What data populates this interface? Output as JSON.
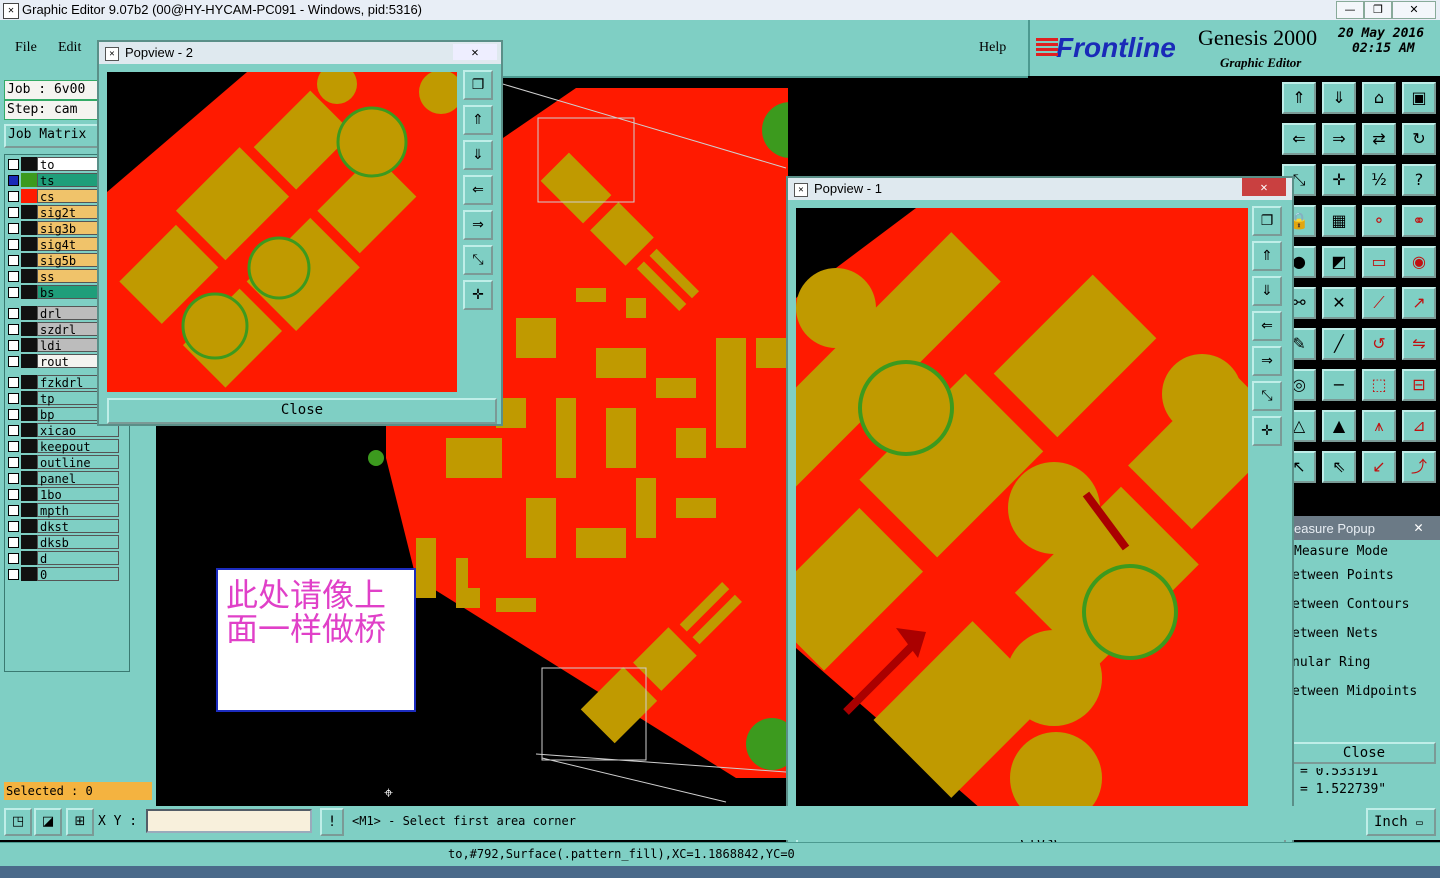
{
  "window": {
    "title": "Graphic Editor 9.07b2 (00@HY-HYCAM-PC091 - Windows, pid:5316)"
  },
  "menu": {
    "file": "File",
    "edit": "Edit",
    "help": "Help"
  },
  "brand": {
    "logo": "Frontline",
    "product": "Genesis 2000",
    "subtitle": "Graphic Editor",
    "date": "20 May 2016",
    "time": "02:15 AM"
  },
  "job": {
    "job_label": "Job : 6v00",
    "step_label": "Step: cam",
    "matrix_button": "Job Matrix"
  },
  "layers": [
    {
      "name": "to",
      "color": "#ffffff"
    },
    {
      "name": "ts",
      "color": "#1f9e7a"
    },
    {
      "name": "cs",
      "color": "#f0c36a"
    },
    {
      "name": "sig2t",
      "color": "#f0c36a"
    },
    {
      "name": "sig3b",
      "color": "#f0c36a"
    },
    {
      "name": "sig4t",
      "color": "#f0c36a"
    },
    {
      "name": "sig5b",
      "color": "#f0c36a"
    },
    {
      "name": "ss",
      "color": "#f0c36a"
    },
    {
      "name": "bs",
      "color": "#1f9e7a"
    },
    {
      "name": "drl",
      "color": "#bcbcbc"
    },
    {
      "name": "szdrl",
      "color": "#bcbcbc"
    },
    {
      "name": "ldi",
      "color": "#bcbcbc"
    },
    {
      "name": "rout",
      "color": "#f4f4f0"
    },
    {
      "name": "fzkdrl",
      "color": "#7fcfc4"
    },
    {
      "name": "tp",
      "color": "#7fcfc4"
    },
    {
      "name": "bp",
      "color": "#7fcfc4"
    },
    {
      "name": "xicao",
      "color": "#7fcfc4"
    },
    {
      "name": "keepout",
      "color": "#7fcfc4"
    },
    {
      "name": "outline",
      "color": "#7fcfc4"
    },
    {
      "name": "panel",
      "color": "#7fcfc4"
    },
    {
      "name": "1bo",
      "color": "#7fcfc4"
    },
    {
      "name": "mpth",
      "color": "#7fcfc4"
    },
    {
      "name": "dkst",
      "color": "#7fcfc4"
    },
    {
      "name": "dksb",
      "color": "#7fcfc4"
    },
    {
      "name": "d",
      "color": "#7fcfc4"
    },
    {
      "name": "0",
      "color": "#7fcfc4"
    }
  ],
  "status": {
    "selected": "Selected : 0",
    "xy_label": "X Y :",
    "xy_value": "",
    "prompt": "<M1> - Select first area corner",
    "units": "Inch",
    "message": "to,#792,Surface(.pattern_fill),XC=1.1868842,YC=0"
  },
  "popview1": {
    "title": "Popview - 1",
    "close": "Close"
  },
  "popview2": {
    "title": "Popview - 2",
    "close": "Close"
  },
  "measure": {
    "title": "easure Popup",
    "mode": "Measure Mode",
    "items": [
      "etween Points",
      "etween Contours",
      "etween Nets",
      "nular Ring",
      "etween Midpoints"
    ],
    "close": "Close",
    "val1": "= 0.533191",
    "val2": "= 1.522739\""
  },
  "note": {
    "text_line1": "此处请像上",
    "text_line2": "面一样做桥"
  },
  "colors": {
    "teal": "#7fcfc4",
    "copper": "#c09a00",
    "red": "#ff1a00",
    "green": "#3c9a1e"
  }
}
